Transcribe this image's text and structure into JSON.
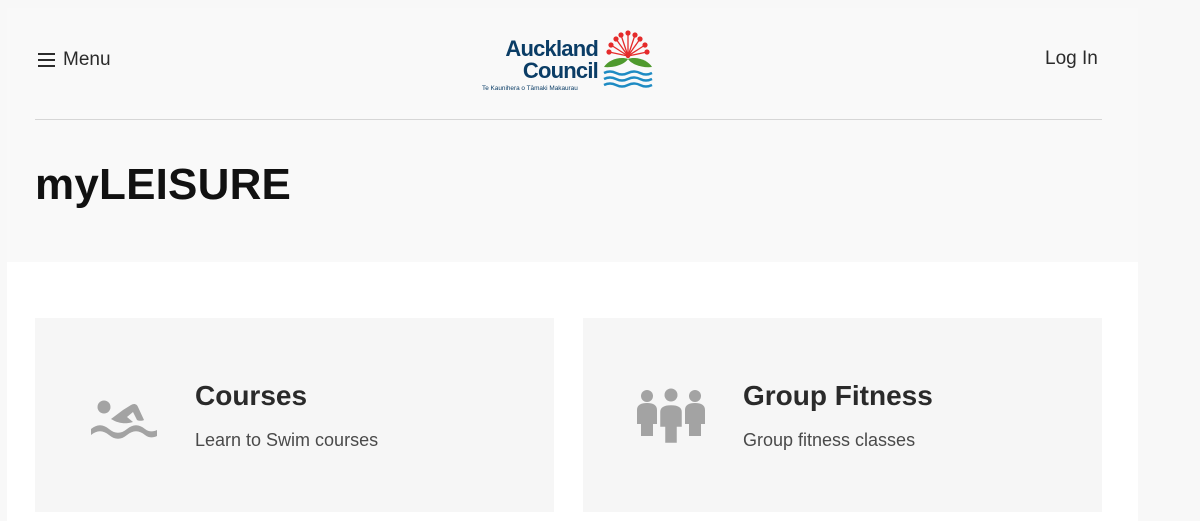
{
  "header": {
    "menu_label": "Menu",
    "login_label": "Log In",
    "logo": {
      "line1": "Auckland",
      "line2": "Council",
      "tagline": "Te Kaunihera o Tāmaki Makaurau",
      "colors": {
        "text": "#0b3d66",
        "flower": "#e52b2b",
        "leaves": "#4f9a2e",
        "waves": "#1e8bc3"
      }
    }
  },
  "page": {
    "title": "myLEISURE"
  },
  "cards": [
    {
      "title": "Courses",
      "description": "Learn to Swim courses",
      "icon": "swimmer-icon"
    },
    {
      "title": "Group Fitness",
      "description": "Group fitness classes",
      "icon": "group-people-icon"
    }
  ],
  "colors": {
    "icon_gray": "#a3a3a3"
  }
}
